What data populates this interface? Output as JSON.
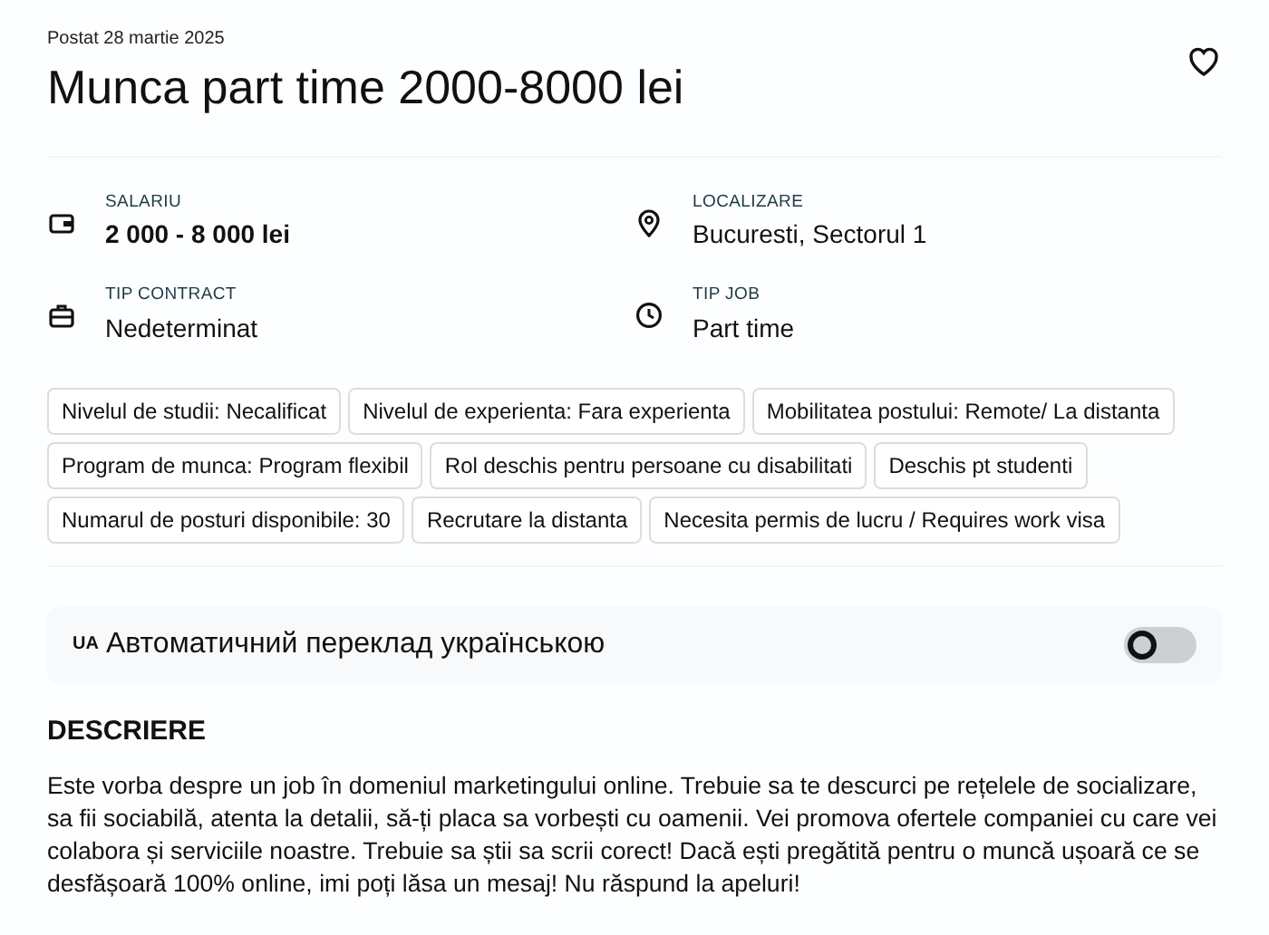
{
  "posted": "Postat 28 martie 2025",
  "favorite": {
    "selected": false
  },
  "title": "Munca part time 2000-8000 lei",
  "details": [
    {
      "kind": "wallet",
      "label": "SALARIU",
      "value": "2 000 - 8 000 lei",
      "bold": true
    },
    {
      "kind": "pin",
      "label": "LOCALIZARE",
      "value": "Bucuresti, Sectorul 1",
      "bold": false
    },
    {
      "kind": "briefcase",
      "label": "TIP CONTRACT",
      "value": "Nedeterminat",
      "bold": false
    },
    {
      "kind": "clock",
      "label": "TIP JOB",
      "value": "Part time",
      "bold": false
    }
  ],
  "tags": [
    [
      "Nivelul de studii: Necalificat",
      "Nivelul de experienta: Fara experienta",
      "Mobilitatea postului: Remote/ La distanta"
    ],
    [
      "Program de munca: Program flexibil",
      "Rol deschis pentru persoane cu disabilitati",
      "Deschis pt studenti"
    ],
    [
      "Numarul de posturi disponibile: 30",
      "Recrutare la distanta",
      "Necesita permis de lucru / Requires work visa"
    ]
  ],
  "translate": {
    "badge": "UA",
    "label": "Автоматичний переклад українською",
    "on": false
  },
  "description": {
    "heading": "DESCRIERE",
    "text": "Este vorba despre un job în domeniul marketingului online. Trebuie sa te descurci pe rețelele de socializare, sa fii sociabilă, atenta la detalii, să-ți placa sa vorbești cu oamenii. Vei promova ofertele companiei cu care vei colabora și serviciile noastre. Trebuie sa știi sa scrii corect! Dacă ești pregătită pentru o muncă ușoară ce se desfășoară 100% online, imi poți lăsa un mesaj! Nu răspund la apeluri!"
  }
}
